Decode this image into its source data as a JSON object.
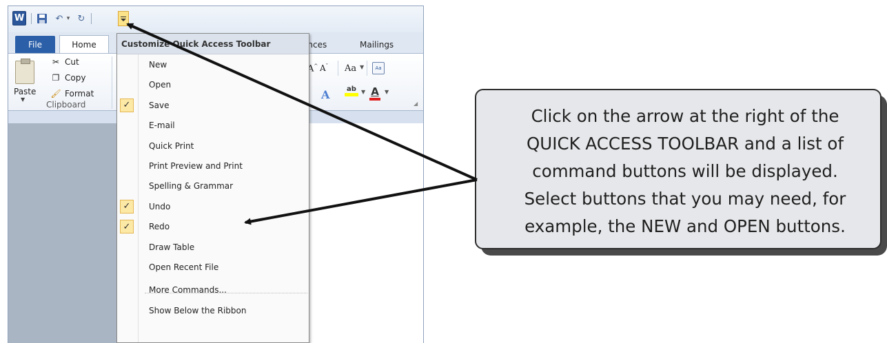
{
  "quick_access_toolbar": {
    "app_icon": "W",
    "save_icon": "save-icon",
    "undo_icon": "undo-icon",
    "redo_icon": "redo-icon"
  },
  "tabs": {
    "file": "File",
    "home": "Home",
    "references_partial": "ences",
    "mailings": "Mailings"
  },
  "ribbon": {
    "paste_label": "Paste",
    "cut_label": "Cut",
    "copy_label": "Copy",
    "format_label": "Format",
    "clipboard_group": "Clipboard",
    "grow_font": "A",
    "shrink_font": "A",
    "change_case": "Aa",
    "font_color": "A",
    "text_effects": "A",
    "highlight": "ab"
  },
  "menu": {
    "header": "Customize Quick Access Toolbar",
    "items": [
      {
        "label": "New",
        "checked": false
      },
      {
        "label": "Open",
        "checked": false
      },
      {
        "label": "Save",
        "checked": true
      },
      {
        "label": "E-mail",
        "checked": false
      },
      {
        "label": "Quick Print",
        "checked": false
      },
      {
        "label": "Print Preview and Print",
        "checked": false
      },
      {
        "label": "Spelling & Grammar",
        "checked": false
      },
      {
        "label": "Undo",
        "checked": true
      },
      {
        "label": "Redo",
        "checked": true
      },
      {
        "label": "Draw Table",
        "checked": false
      },
      {
        "label": "Open Recent File",
        "checked": false
      },
      {
        "label": "More Commands...",
        "checked": false
      },
      {
        "label": "Show Below the Ribbon",
        "checked": false
      }
    ]
  },
  "callout": {
    "line1": "Click on the arrow at the right of the",
    "line2": "QUICK ACCESS TOOLBAR and a list of",
    "line3": "command buttons will be displayed.",
    "line4": "Select buttons that you may need, for",
    "line5": "example, the NEW and OPEN buttons."
  },
  "colors": {
    "file_tab": "#2b5fa8",
    "check_highlight": "#fde9a6",
    "dropdown_highlight": "#fbe38a"
  }
}
